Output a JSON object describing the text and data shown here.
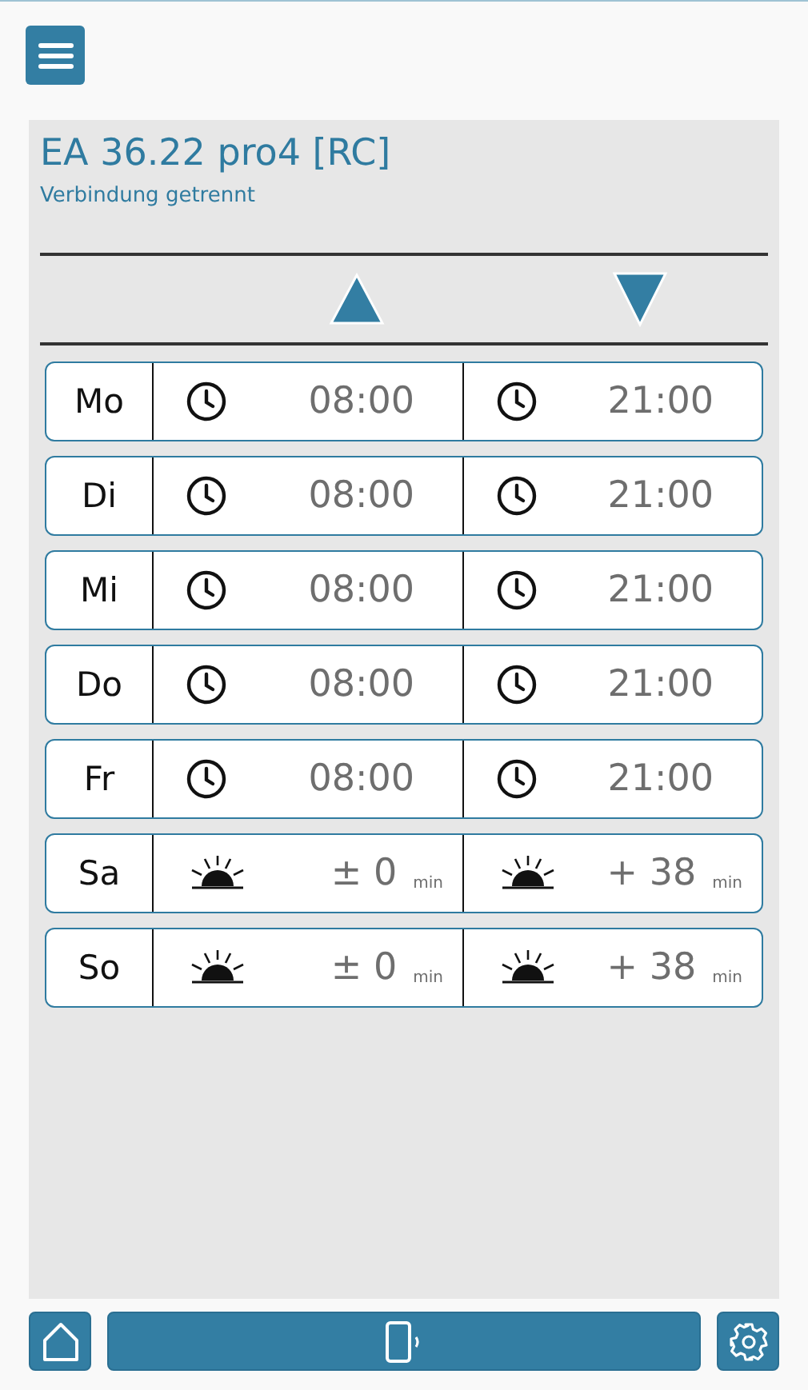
{
  "header": {
    "title": "EA 36.22 pro4 [RC]",
    "status": "Verbindung getrennt"
  },
  "days": [
    {
      "day": "Mo",
      "up": {
        "kind": "clock",
        "value": "08:00"
      },
      "down": {
        "kind": "clock",
        "value": "21:00"
      }
    },
    {
      "day": "Di",
      "up": {
        "kind": "clock",
        "value": "08:00"
      },
      "down": {
        "kind": "clock",
        "value": "21:00"
      }
    },
    {
      "day": "Mi",
      "up": {
        "kind": "clock",
        "value": "08:00"
      },
      "down": {
        "kind": "clock",
        "value": "21:00"
      }
    },
    {
      "day": "Do",
      "up": {
        "kind": "clock",
        "value": "08:00"
      },
      "down": {
        "kind": "clock",
        "value": "21:00"
      }
    },
    {
      "day": "Fr",
      "up": {
        "kind": "clock",
        "value": "08:00"
      },
      "down": {
        "kind": "clock",
        "value": "21:00"
      }
    },
    {
      "day": "Sa",
      "up": {
        "kind": "sun",
        "value": "± 0",
        "unit": "min"
      },
      "down": {
        "kind": "sun",
        "value": "+ 38",
        "unit": "min"
      }
    },
    {
      "day": "So",
      "up": {
        "kind": "sun",
        "value": "± 0",
        "unit": "min"
      },
      "down": {
        "kind": "sun",
        "value": "+ 38",
        "unit": "min"
      }
    }
  ]
}
